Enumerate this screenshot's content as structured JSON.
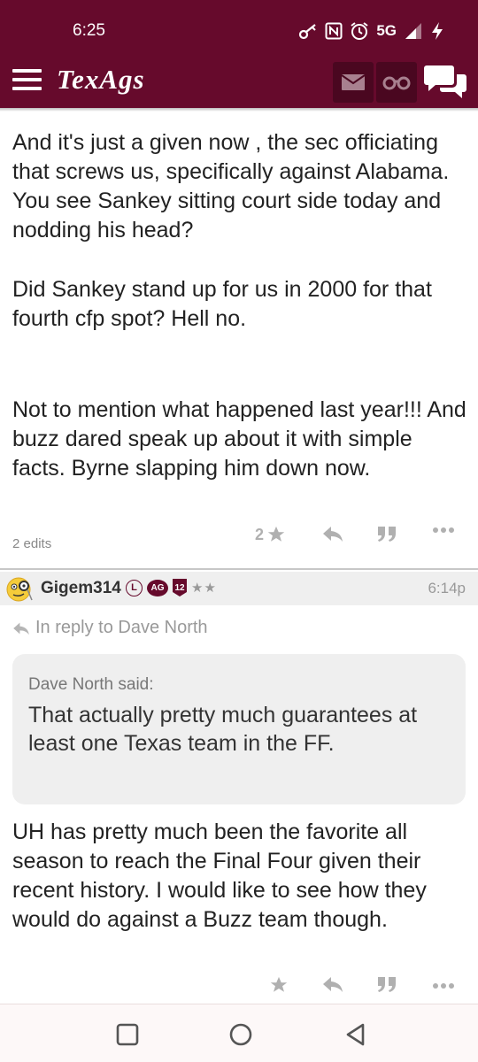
{
  "status_bar": {
    "time": "6:25",
    "network": "5G",
    "icons": [
      "key-icon",
      "nfc-icon",
      "alarm-icon",
      "signal-icon",
      "charging-icon"
    ]
  },
  "app_bar": {
    "logo": "TexAgs",
    "icons": [
      "menu-icon",
      "mail-icon",
      "binoculars-icon",
      "chat-icon"
    ],
    "brand_color": "#660a2c"
  },
  "post1": {
    "paragraphs": [
      "And it's just a given now , the sec officiating that screws us, specifically against Alabama. You see Sankey sitting court side today and nodding his head?",
      "Did Sankey stand up for us in 2000 for that fourth cfp spot? Hell no.",
      "Not to mention what happened last year!!! And buzz dared speak up about it with simple facts. Byrne slapping him down now."
    ],
    "edits": "2 edits",
    "star_count": "2"
  },
  "post2": {
    "username": "Gigem314",
    "badges": [
      "L",
      "AG",
      "12"
    ],
    "stars": "★★",
    "time": "6:14p",
    "reply_to": "In reply to Dave North",
    "quote_author": "Dave North said:",
    "quote_text": "That actually pretty much guarantees at least one Texas team in the FF.",
    "body": "UH has pretty much been the favorite all season to reach the Final Four given their recent history. I would like to see how they would do against a Buzz team though."
  },
  "nav_bar": {
    "icons": [
      "recents-icon",
      "home-icon",
      "back-icon"
    ]
  }
}
